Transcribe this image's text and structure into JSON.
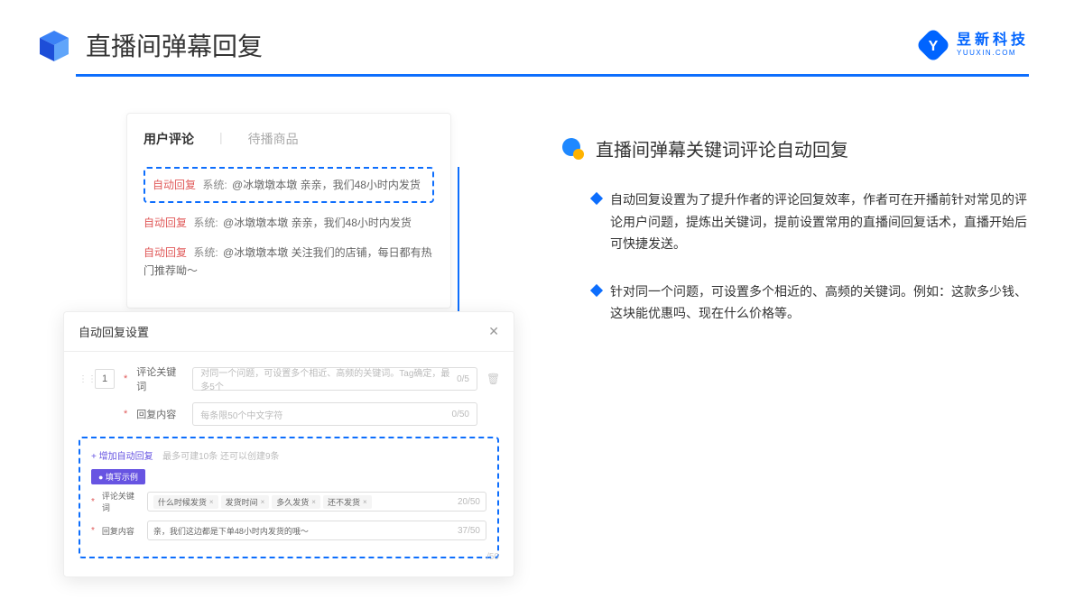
{
  "header": {
    "title": "直播间弹幕回复",
    "logo_cn": "昱新科技",
    "logo_en": "YUUXIN.COM"
  },
  "comments_card": {
    "tab_active": "用户评论",
    "tab_inactive": "待播商品",
    "highlighted": {
      "label": "自动回复",
      "system": "系统:",
      "text": "@冰墩墩本墩 亲亲，我们48小时内发货"
    },
    "items": [
      {
        "label": "自动回复",
        "system": "系统:",
        "text": "@冰墩墩本墩 亲亲，我们48小时内发货"
      },
      {
        "label": "自动回复",
        "system": "系统:",
        "text": "@冰墩墩本墩 关注我们的店铺，每日都有热门推荐呦～"
      }
    ]
  },
  "settings": {
    "title": "自动回复设置",
    "order": "1",
    "keyword_label": "评论关键词",
    "keyword_placeholder": "对同一个问题，可设置多个相近、高频的关键词。Tag确定，最多5个",
    "keyword_counter": "0/5",
    "content_label": "回复内容",
    "content_placeholder": "每条限50个中文字符",
    "content_counter": "0/50",
    "add_link": "+ 增加自动回复",
    "add_hint": "最多可建10条 还可以创建9条",
    "example_badge": "● 填写示例",
    "ex_keyword_label": "评论关键词",
    "ex_tags": [
      "什么时候发货",
      "发货时间",
      "多久发货",
      "还不发货"
    ],
    "ex_kw_counter": "20/50",
    "ex_content_label": "回复内容",
    "ex_content_text": "亲，我们这边都是下单48小时内发货的哦～",
    "ex_content_counter": "37/50",
    "ghost_counter": "/50"
  },
  "right": {
    "sub_heading": "直播间弹幕关键词评论自动回复",
    "bullets": [
      "自动回复设置为了提升作者的评论回复效率，作者可在开播前针对常见的评论用户问题，提炼出关键词，提前设置常用的直播间回复话术，直播开始后可快捷发送。",
      "针对同一个问题，可设置多个相近的、高频的关键词。例如：这款多少钱、这块能优惠吗、现在什么价格等。"
    ]
  }
}
